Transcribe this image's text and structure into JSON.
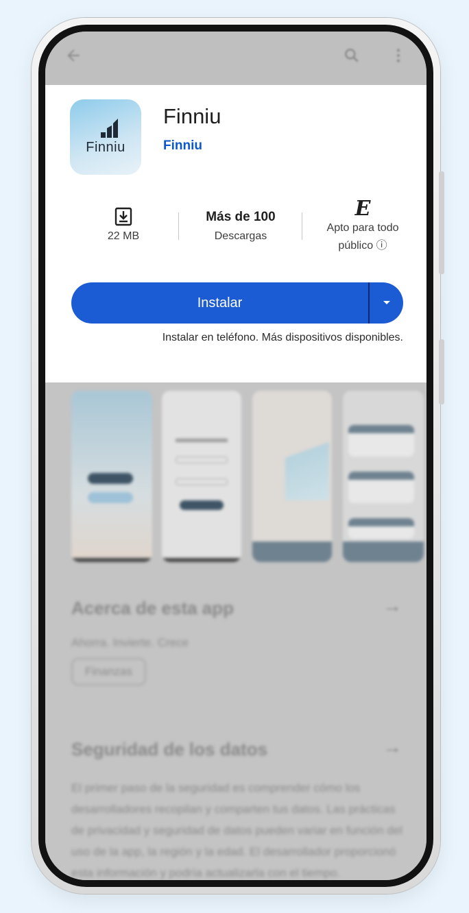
{
  "app": {
    "name": "Finniu",
    "developer": "Finniu",
    "icon_label": "Finniu"
  },
  "stats": {
    "size": "22 MB",
    "downloads_value": "Más de 100",
    "downloads_label": "Descargas",
    "rating_badge": "E",
    "rating_line1": "Apto para todo",
    "rating_line2": "público ⓘ"
  },
  "install": {
    "label": "Instalar",
    "note": "Instalar en teléfono. Más dispositivos disponibles."
  },
  "about": {
    "title": "Acerca de esta app",
    "tagline": "Ahorra. Invierte. Crece",
    "chip": "Finanzas"
  },
  "data_safety": {
    "title": "Seguridad de los datos",
    "body": "El primer paso de la seguridad es comprender cómo los desarrolladores recopilan y comparten tus datos. Las prácticas de privacidad y seguridad de datos pueden variar en función del uso de la app, la región y la edad. El desarrollador proporcionó esta información y podría actualizarla con el tiempo."
  },
  "icons": {
    "back": "arrow-back-icon",
    "search": "search-icon",
    "menu": "more-vert-icon",
    "download": "download-icon",
    "dropdown": "caret-down-icon",
    "arrow": "arrow-forward-icon"
  },
  "colors": {
    "page_bg": "#e9f4fc",
    "install_button": "#1b5bd3",
    "developer_link": "#0b57d0"
  }
}
